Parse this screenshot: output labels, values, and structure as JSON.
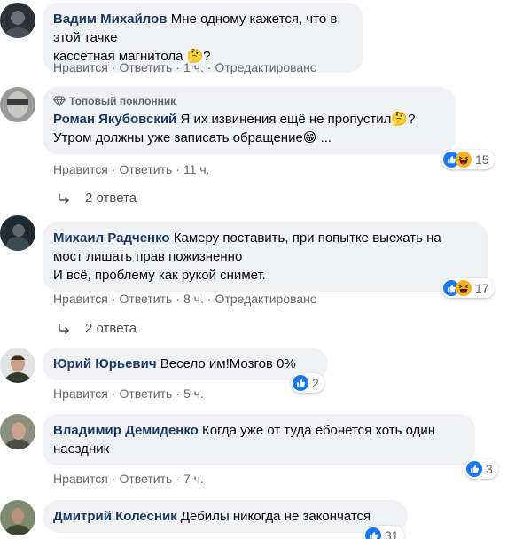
{
  "colors": {
    "accent": "#1877f2",
    "bubble": "#f0f2f5",
    "author": "#1c3a63",
    "meta": "#65676b"
  },
  "comments": [
    {
      "author": "Вадим Михайлов",
      "text_lines": [
        "Мне одному кажется, что в этой тачке",
        "кассетная магнитола 🤔?"
      ],
      "like_label": "Нравится",
      "reply_label": "Ответить",
      "time": "1 ч.",
      "edited": "Отредактировано"
    },
    {
      "badge": "Топовый поклонник",
      "badge_icon": "diamond-icon",
      "author": "Роман Якубовский",
      "text_lines": [
        "Я их извинения ещё не пропустил🤔?",
        "Утром должны уже записать обращение😁 ..."
      ],
      "like_label": "Нравится",
      "reply_label": "Ответить",
      "time": "11 ч.",
      "reaction_icons": [
        "like-icon",
        "haha-icon"
      ],
      "reaction_count": "15",
      "replies_label": "2 ответа"
    },
    {
      "author": "Михаил Радченко",
      "text_lines": [
        "Камеру поставить, при попытке выехать на",
        "мост лишать прав пожизненно",
        "И всё, проблему как рукой снимет."
      ],
      "like_label": "Нравится",
      "reply_label": "Ответить",
      "time": "8 ч.",
      "edited": "Отредактировано",
      "reaction_icons": [
        "like-icon",
        "haha-icon"
      ],
      "reaction_count": "17",
      "replies_label": "2 ответа"
    },
    {
      "author": "Юрий Юрьевич",
      "text_lines": [
        "Весело им!Мозгов 0%"
      ],
      "like_label": "Нравится",
      "reply_label": "Ответить",
      "time": "5 ч.",
      "reaction_icons": [
        "like-icon"
      ],
      "reaction_count": "2"
    },
    {
      "author": "Владимир Демиденко",
      "text_lines": [
        "Когда уже от туда ебонется хоть один",
        "наездник"
      ],
      "like_label": "Нравится",
      "reply_label": "Ответить",
      "time": "7 ч.",
      "reaction_icons": [
        "like-icon"
      ],
      "reaction_count": "3"
    },
    {
      "author": "Дмитрий Колесник",
      "text_lines": [
        "Дебилы никогда не закончатся"
      ],
      "reaction_icons": [
        "like-icon"
      ],
      "reaction_count": "31"
    }
  ]
}
